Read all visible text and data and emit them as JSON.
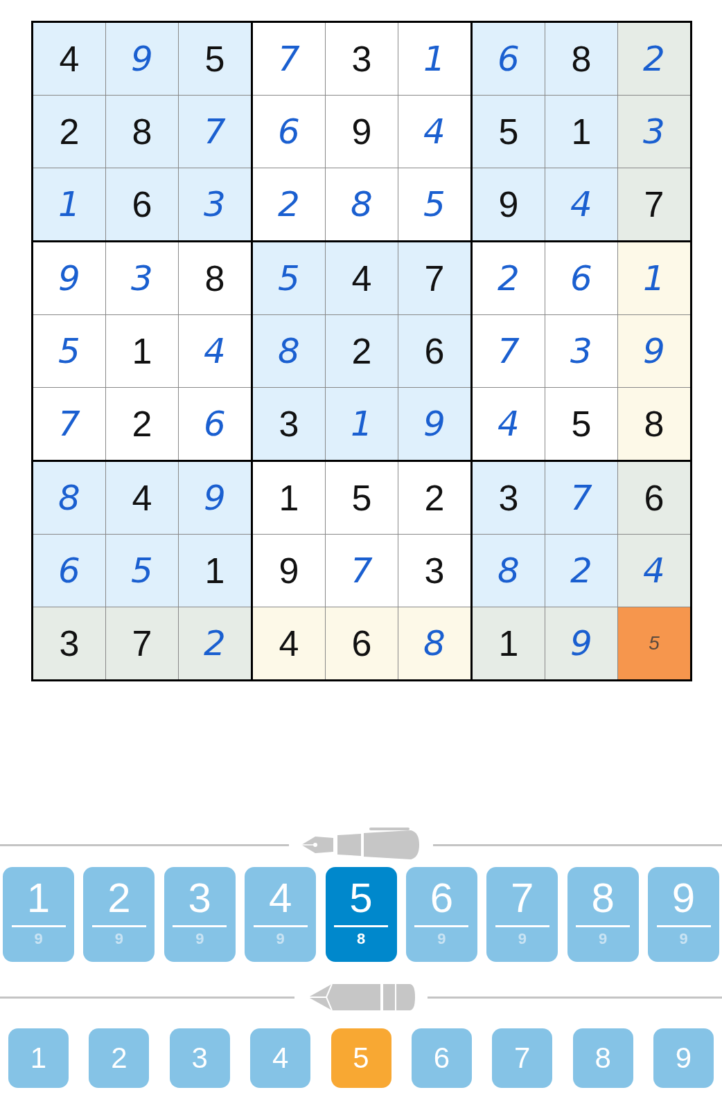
{
  "grid": [
    [
      {
        "value": "4",
        "kind": "given",
        "highlighted": false,
        "selected": false
      },
      {
        "value": "9",
        "kind": "entered",
        "highlighted": false,
        "selected": false
      },
      {
        "value": "5",
        "kind": "given",
        "highlighted": false,
        "selected": false
      },
      {
        "value": "7",
        "kind": "entered",
        "highlighted": false,
        "selected": false
      },
      {
        "value": "3",
        "kind": "given",
        "highlighted": false,
        "selected": false
      },
      {
        "value": "1",
        "kind": "entered",
        "highlighted": false,
        "selected": false
      },
      {
        "value": "6",
        "kind": "entered",
        "highlighted": false,
        "selected": false
      },
      {
        "value": "8",
        "kind": "given",
        "highlighted": false,
        "selected": false
      },
      {
        "value": "2",
        "kind": "entered",
        "highlighted": true,
        "selected": false
      }
    ],
    [
      {
        "value": "2",
        "kind": "given",
        "highlighted": false,
        "selected": false
      },
      {
        "value": "8",
        "kind": "given",
        "highlighted": false,
        "selected": false
      },
      {
        "value": "7",
        "kind": "entered",
        "highlighted": false,
        "selected": false
      },
      {
        "value": "6",
        "kind": "entered",
        "highlighted": false,
        "selected": false
      },
      {
        "value": "9",
        "kind": "given",
        "highlighted": false,
        "selected": false
      },
      {
        "value": "4",
        "kind": "entered",
        "highlighted": false,
        "selected": false
      },
      {
        "value": "5",
        "kind": "given",
        "highlighted": false,
        "selected": false
      },
      {
        "value": "1",
        "kind": "given",
        "highlighted": false,
        "selected": false
      },
      {
        "value": "3",
        "kind": "entered",
        "highlighted": true,
        "selected": false
      }
    ],
    [
      {
        "value": "1",
        "kind": "entered",
        "highlighted": false,
        "selected": false
      },
      {
        "value": "6",
        "kind": "given",
        "highlighted": false,
        "selected": false
      },
      {
        "value": "3",
        "kind": "entered",
        "highlighted": false,
        "selected": false
      },
      {
        "value": "2",
        "kind": "entered",
        "highlighted": false,
        "selected": false
      },
      {
        "value": "8",
        "kind": "entered",
        "highlighted": false,
        "selected": false
      },
      {
        "value": "5",
        "kind": "entered",
        "highlighted": false,
        "selected": false
      },
      {
        "value": "9",
        "kind": "given",
        "highlighted": false,
        "selected": false
      },
      {
        "value": "4",
        "kind": "entered",
        "highlighted": false,
        "selected": false
      },
      {
        "value": "7",
        "kind": "given",
        "highlighted": true,
        "selected": false
      }
    ],
    [
      {
        "value": "9",
        "kind": "entered",
        "highlighted": false,
        "selected": false
      },
      {
        "value": "3",
        "kind": "entered",
        "highlighted": false,
        "selected": false
      },
      {
        "value": "8",
        "kind": "given",
        "highlighted": false,
        "selected": false
      },
      {
        "value": "5",
        "kind": "entered",
        "highlighted": false,
        "selected": false
      },
      {
        "value": "4",
        "kind": "given",
        "highlighted": false,
        "selected": false
      },
      {
        "value": "7",
        "kind": "given",
        "highlighted": false,
        "selected": false
      },
      {
        "value": "2",
        "kind": "entered",
        "highlighted": false,
        "selected": false
      },
      {
        "value": "6",
        "kind": "entered",
        "highlighted": false,
        "selected": false
      },
      {
        "value": "1",
        "kind": "entered",
        "highlighted": true,
        "selected": false
      }
    ],
    [
      {
        "value": "5",
        "kind": "entered",
        "highlighted": false,
        "selected": false
      },
      {
        "value": "1",
        "kind": "given",
        "highlighted": false,
        "selected": false
      },
      {
        "value": "4",
        "kind": "entered",
        "highlighted": false,
        "selected": false
      },
      {
        "value": "8",
        "kind": "entered",
        "highlighted": false,
        "selected": false
      },
      {
        "value": "2",
        "kind": "given",
        "highlighted": false,
        "selected": false
      },
      {
        "value": "6",
        "kind": "given",
        "highlighted": false,
        "selected": false
      },
      {
        "value": "7",
        "kind": "entered",
        "highlighted": false,
        "selected": false
      },
      {
        "value": "3",
        "kind": "entered",
        "highlighted": false,
        "selected": false
      },
      {
        "value": "9",
        "kind": "entered",
        "highlighted": true,
        "selected": false
      }
    ],
    [
      {
        "value": "7",
        "kind": "entered",
        "highlighted": false,
        "selected": false
      },
      {
        "value": "2",
        "kind": "given",
        "highlighted": false,
        "selected": false
      },
      {
        "value": "6",
        "kind": "entered",
        "highlighted": false,
        "selected": false
      },
      {
        "value": "3",
        "kind": "given",
        "highlighted": false,
        "selected": false
      },
      {
        "value": "1",
        "kind": "entered",
        "highlighted": false,
        "selected": false
      },
      {
        "value": "9",
        "kind": "entered",
        "highlighted": false,
        "selected": false
      },
      {
        "value": "4",
        "kind": "entered",
        "highlighted": false,
        "selected": false
      },
      {
        "value": "5",
        "kind": "given",
        "highlighted": false,
        "selected": false
      },
      {
        "value": "8",
        "kind": "given",
        "highlighted": true,
        "selected": false
      }
    ],
    [
      {
        "value": "8",
        "kind": "entered",
        "highlighted": false,
        "selected": false
      },
      {
        "value": "4",
        "kind": "given",
        "highlighted": false,
        "selected": false
      },
      {
        "value": "9",
        "kind": "entered",
        "highlighted": false,
        "selected": false
      },
      {
        "value": "1",
        "kind": "given",
        "highlighted": false,
        "selected": false
      },
      {
        "value": "5",
        "kind": "given",
        "highlighted": false,
        "selected": false
      },
      {
        "value": "2",
        "kind": "given",
        "highlighted": false,
        "selected": false
      },
      {
        "value": "3",
        "kind": "given",
        "highlighted": false,
        "selected": false
      },
      {
        "value": "7",
        "kind": "entered",
        "highlighted": false,
        "selected": false
      },
      {
        "value": "6",
        "kind": "given",
        "highlighted": true,
        "selected": false
      }
    ],
    [
      {
        "value": "6",
        "kind": "entered",
        "highlighted": false,
        "selected": false
      },
      {
        "value": "5",
        "kind": "entered",
        "highlighted": false,
        "selected": false
      },
      {
        "value": "1",
        "kind": "given",
        "highlighted": false,
        "selected": false
      },
      {
        "value": "9",
        "kind": "given",
        "highlighted": false,
        "selected": false
      },
      {
        "value": "7",
        "kind": "entered",
        "highlighted": false,
        "selected": false
      },
      {
        "value": "3",
        "kind": "given",
        "highlighted": false,
        "selected": false
      },
      {
        "value": "8",
        "kind": "entered",
        "highlighted": false,
        "selected": false
      },
      {
        "value": "2",
        "kind": "entered",
        "highlighted": false,
        "selected": false
      },
      {
        "value": "4",
        "kind": "entered",
        "highlighted": true,
        "selected": false
      }
    ],
    [
      {
        "value": "3",
        "kind": "given",
        "highlighted": true,
        "selected": false
      },
      {
        "value": "7",
        "kind": "given",
        "highlighted": true,
        "selected": false
      },
      {
        "value": "2",
        "kind": "entered",
        "highlighted": true,
        "selected": false
      },
      {
        "value": "4",
        "kind": "given",
        "highlighted": true,
        "selected": false
      },
      {
        "value": "6",
        "kind": "given",
        "highlighted": true,
        "selected": false
      },
      {
        "value": "8",
        "kind": "entered",
        "highlighted": true,
        "selected": false
      },
      {
        "value": "1",
        "kind": "given",
        "highlighted": true,
        "selected": false
      },
      {
        "value": "9",
        "kind": "entered",
        "highlighted": true,
        "selected": false
      },
      {
        "value": "5",
        "kind": "note",
        "highlighted": false,
        "selected": true
      }
    ]
  ],
  "pen_digits": [
    {
      "digit": "1",
      "count": "9",
      "selected": false
    },
    {
      "digit": "2",
      "count": "9",
      "selected": false
    },
    {
      "digit": "3",
      "count": "9",
      "selected": false
    },
    {
      "digit": "4",
      "count": "9",
      "selected": false
    },
    {
      "digit": "5",
      "count": "8",
      "selected": true
    },
    {
      "digit": "6",
      "count": "9",
      "selected": false
    },
    {
      "digit": "7",
      "count": "9",
      "selected": false
    },
    {
      "digit": "8",
      "count": "9",
      "selected": false
    },
    {
      "digit": "9",
      "count": "9",
      "selected": false
    }
  ],
  "pencil_digits": [
    {
      "digit": "1",
      "selected": false
    },
    {
      "digit": "2",
      "selected": false
    },
    {
      "digit": "3",
      "selected": false
    },
    {
      "digit": "4",
      "selected": false
    },
    {
      "digit": "5",
      "selected": true
    },
    {
      "digit": "6",
      "selected": false
    },
    {
      "digit": "7",
      "selected": false
    },
    {
      "digit": "8",
      "selected": false
    },
    {
      "digit": "9",
      "selected": false
    }
  ]
}
